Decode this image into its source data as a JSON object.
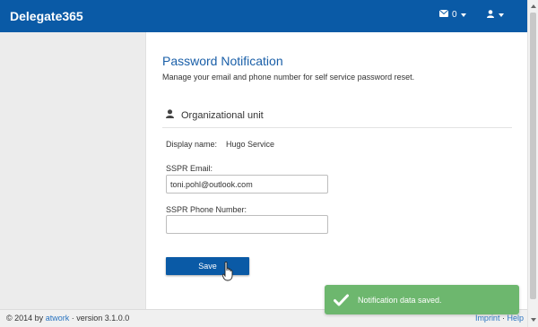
{
  "app": {
    "brand": "Delegate365"
  },
  "navbar": {
    "messages_count": "0",
    "envelope_icon": "envelope-icon",
    "user_icon": "user-icon"
  },
  "page": {
    "title": "Password Notification",
    "subtitle": "Manage your email and phone number for self service password reset."
  },
  "section": {
    "title": "Organizational unit",
    "icon": "user-icon"
  },
  "form": {
    "display_name_label": "Display name:",
    "display_name_value": "Hugo Service",
    "email_label": "SSPR Email:",
    "email_value": "toni.pohl@outlook.com",
    "phone_label": "SSPR Phone Number:",
    "phone_value": "",
    "save_label": "Save"
  },
  "footer": {
    "copyright_prefix": "© 2014 by",
    "company_link": "atwork",
    "version_text": "· version 3.1.0.0",
    "imprint_link": "Imprint",
    "separator": "·",
    "help_link": "Help"
  },
  "toast": {
    "message": "Notification data saved.",
    "icon": "check-icon"
  },
  "colors": {
    "primary": "#0a5aa6",
    "title": "#1a5fa8",
    "success": "#6db76e",
    "link": "#2a74c0"
  }
}
